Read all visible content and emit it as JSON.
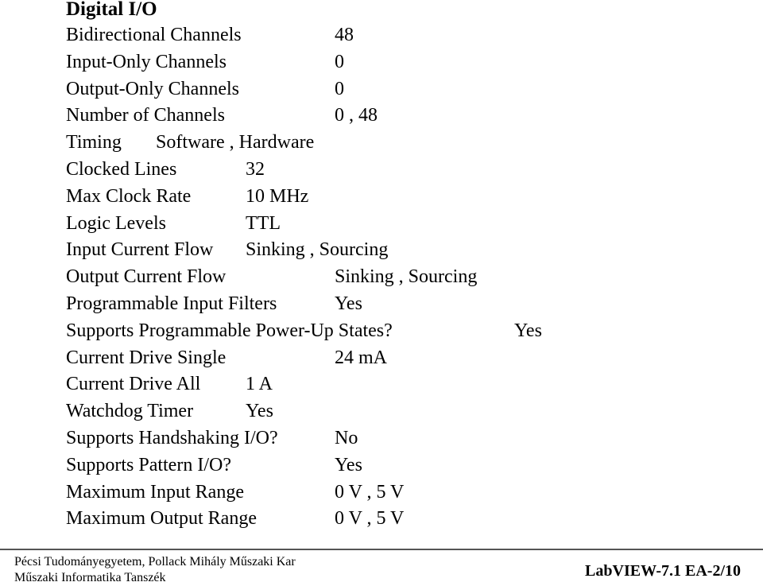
{
  "title": "Digital I/O",
  "rows": [
    {
      "label": "Bidirectional Channels",
      "value": "48"
    },
    {
      "label": "Input-Only Channels",
      "value": "0"
    },
    {
      "label": "Output-Only Channels",
      "value": "0"
    },
    {
      "label": "Number of Channels",
      "value": "0 , 48"
    },
    {
      "label": "Timing",
      "value": "Software , Hardware"
    },
    {
      "label": "Clocked Lines",
      "value": "32"
    },
    {
      "label": "Max Clock Rate",
      "value": "10 MHz"
    },
    {
      "label": "Logic Levels",
      "value": "TTL"
    },
    {
      "label": "Input Current Flow",
      "value": "Sinking , Sourcing"
    },
    {
      "label": "Output Current Flow",
      "value": "Sinking , Sourcing"
    },
    {
      "label": "Programmable Input Filters",
      "value": "Yes"
    },
    {
      "label": "Supports Programmable Power-Up States?",
      "value": "Yes"
    },
    {
      "label": "Current Drive Single",
      "value": "24 mA"
    },
    {
      "label": "Current Drive All",
      "value": "1 A"
    },
    {
      "label": "Watchdog Timer",
      "value": "Yes"
    },
    {
      "label": "Supports Handshaking I/O?",
      "value": "No"
    },
    {
      "label": "Supports Pattern I/O?",
      "value": "Yes"
    },
    {
      "label": "Maximum Input Range",
      "value": "0 V , 5 V"
    },
    {
      "label": "Maximum Output Range",
      "value": "0 V , 5 V"
    }
  ],
  "footer": {
    "institution_line1": "Pécsi Tudományegyetem, Pollack Mihály Műszaki Kar",
    "institution_line2": "Műszaki Informatika Tanszék",
    "slide_id": "LabVIEW-7.1 EA-2/10"
  }
}
